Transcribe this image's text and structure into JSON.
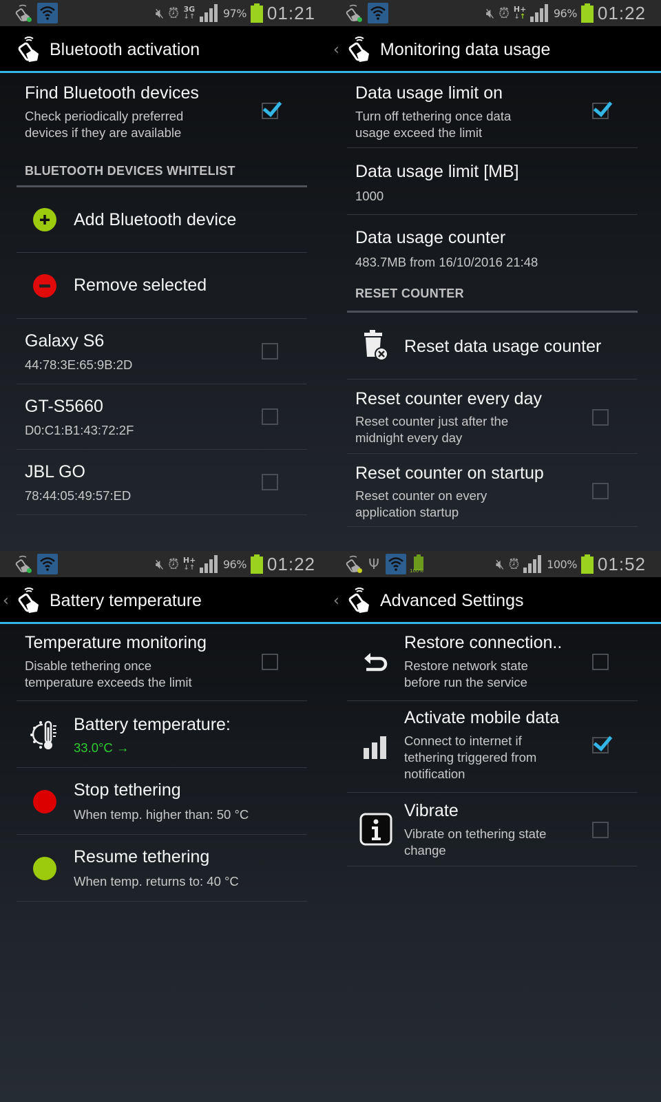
{
  "screens": [
    {
      "status": {
        "network": "3G",
        "battery_pct": "97%",
        "time": "01:21"
      },
      "title": "Bluetooth activation",
      "find_bt": {
        "title": "Find Bluetooth devices",
        "sub1": "Check periodically preferred",
        "sub2": "devices if they are available",
        "checked": true
      },
      "section": "BLUETOOTH DEVICES WHITELIST",
      "add_label": "Add Bluetooth device",
      "remove_label": "Remove selected",
      "devices": [
        {
          "name": "Galaxy S6",
          "mac": "44:78:3E:65:9B:2D",
          "checked": false
        },
        {
          "name": "GT-S5660",
          "mac": "D0:C1:B1:43:72:2F",
          "checked": false
        },
        {
          "name": "JBL GO",
          "mac": "78:44:05:49:57:ED",
          "checked": false
        }
      ]
    },
    {
      "status": {
        "network": "H+",
        "battery_pct": "96%",
        "time": "01:22"
      },
      "title": "Monitoring data usage",
      "limit_on": {
        "title": "Data usage limit on",
        "sub1": "Turn off tethering once data",
        "sub2": "usage exceed the limit",
        "checked": true
      },
      "limit_mb": {
        "title": "Data usage limit [MB]",
        "value": "1000"
      },
      "counter": {
        "title": "Data usage counter",
        "value": "483.7MB from 16/10/2016 21:48"
      },
      "section": "RESET COUNTER",
      "reset_label": "Reset data usage counter",
      "reset_daily": {
        "title": "Reset counter every day",
        "sub1": "Reset counter just after the",
        "sub2": "midnight every day",
        "checked": false
      },
      "reset_startup": {
        "title": "Reset counter on startup",
        "sub1": "Reset counter on every",
        "sub2": "application startup",
        "checked": false
      }
    },
    {
      "status": {
        "network": "H+",
        "battery_pct": "96%",
        "time": "01:22"
      },
      "title": "Battery temperature",
      "monitoring": {
        "title": "Temperature monitoring",
        "sub1": "Disable tethering once",
        "sub2": "temperature exceeds the limit",
        "checked": false
      },
      "battery_temp": {
        "title": "Battery temperature:",
        "value": "33.0°C →",
        "color": "#2ecc2e"
      },
      "stop": {
        "title": "Stop tethering",
        "sub": "When temp. higher than: 50 °C",
        "color": "#dd0000"
      },
      "resume": {
        "title": "Resume tethering",
        "sub": "When temp. returns to: 40 °C",
        "color": "#9ccb0e"
      }
    },
    {
      "status": {
        "battery_small_label": "100%",
        "battery_pct": "100%",
        "time": "01:52"
      },
      "title": "Advanced Settings",
      "restore": {
        "title": "Restore connection..",
        "sub1": "Restore network state",
        "sub2": "before run the service",
        "checked": false
      },
      "mobile_data": {
        "title": "Activate mobile data",
        "sub1": "Connect to internet if",
        "sub2": "tethering triggered from",
        "sub3": "notification",
        "checked": true
      },
      "vibrate": {
        "title": "Vibrate",
        "sub1": "Vibrate on tethering state",
        "sub2": "change",
        "checked": false
      }
    }
  ],
  "colors": {
    "accent": "#33b5e5",
    "battery": "#9bd21f"
  }
}
